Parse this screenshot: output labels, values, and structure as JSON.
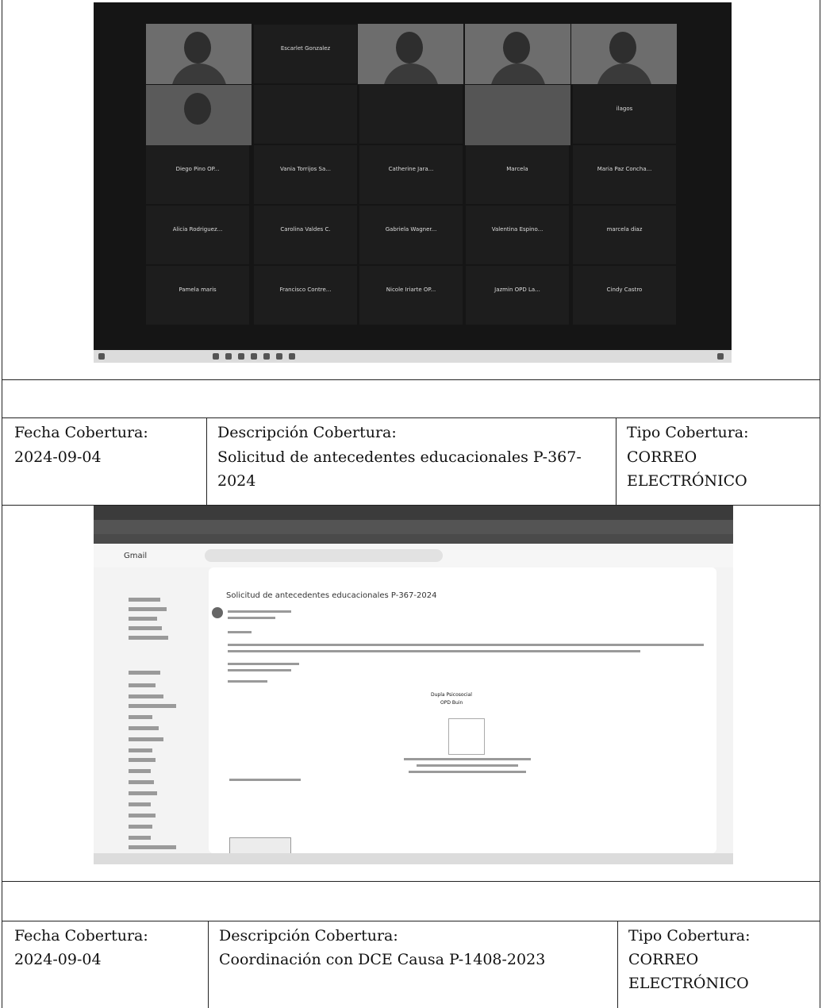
{
  "rows": [
    {
      "fecha_label": "Fecha Cobertura:",
      "fecha_value": "2024-09-04",
      "descripcion_label": "Descripción Cobertura:",
      "descripcion_line1": "Solicitud de antecedentes educacionales P-367-",
      "descripcion_line2": "2024",
      "tipo_label": "Tipo Cobertura:",
      "tipo_line1": "CORREO",
      "tipo_line2": "ELECTRÓNICO"
    },
    {
      "fecha_label": "Fecha Cobertura:",
      "fecha_value": "2024-09-04",
      "descripcion_label": "Descripción Cobertura:",
      "descripcion_line1": "Coordinación con DCE Causa P-1408-2023",
      "tipo_label": "Tipo Cobertura:",
      "tipo_line1": "CORREO",
      "tipo_line2": "ELECTRÓNICO"
    }
  ],
  "zoom_screenshot": {
    "participants": [
      "Escarlet Gonzalez",
      "Diego Pino OP...",
      "Vania Torrijos Sa...",
      "Catherine Jara...",
      "Marcela",
      "Maria Paz Concha...",
      "Alicia Rodriguez...",
      "Carolina Valdes C.",
      "Gabriela Wagner...",
      "Valentina Espino...",
      "marcela diaz",
      "Pamela maris",
      "Francisco Contre...",
      "Nicole Iriarte OP...",
      "Jazmin OPD La...",
      "Cindy Castro"
    ],
    "partial_label": "ilagos"
  },
  "gmail_screenshot": {
    "app_name": "Gmail",
    "subject": "Solicitud de antecedentes educacionales P-367-2024",
    "sig_title": "Dupla Psicosocial",
    "sig_org": "OPD Buin"
  }
}
